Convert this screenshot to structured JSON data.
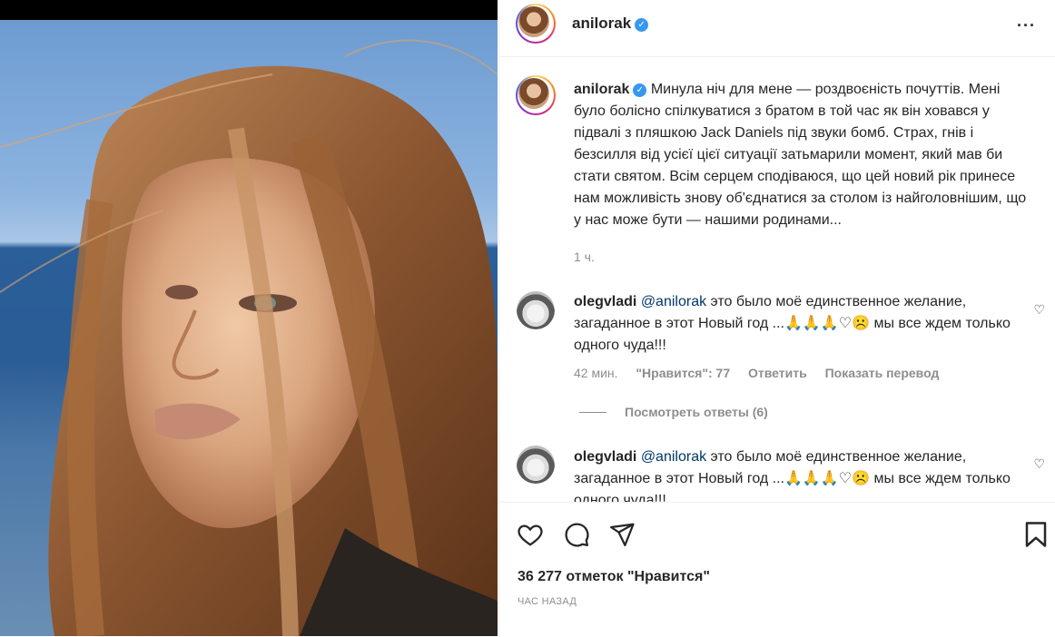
{
  "post": {
    "username": "anilorak",
    "verified_mark": "✓",
    "more_icon": "···",
    "caption": "Минула ніч для мене — роздвоєність почуттів. Мені було болісно спілкуватися з братом в той час як він ховався у підвалі з пляшкою Jack Daniels під звуки бомб. Страх, гнів і безсилля від усієї цієї ситуації затьмарили момент, який мав би стати святом. Всім серцем сподіваюся, що цей новий рік принесе нам можливість знову об'єднатися за столом із найголовнішим, що у нас може бути — нашими родинами...",
    "caption_time": "1 ч."
  },
  "comments": [
    {
      "username": "olegvladi",
      "mention": "@anilorak",
      "text": "это было моё единственное желание, загаданное в этот Новый год ...🙏🙏🙏♡☹️ мы все ждем только одного чуда!!!",
      "time": "42 мин.",
      "likes": "\"Нравится\": 77",
      "reply": "Ответить",
      "translate": "Показать перевод",
      "view_replies": "Посмотреть ответы (6)"
    },
    {
      "username": "olegvladi",
      "mention": "@anilorak",
      "text": "это было моё единственное желание, загаданное в этот Новый год ...🙏🙏🙏♡☹️ мы все ждем только одного чуда!!!"
    }
  ],
  "footer": {
    "likes_text": "36 277 отметок \"Нравится\"",
    "time_text": "ЧАС НАЗАД"
  },
  "colors": {
    "text": "#262626",
    "muted": "#8e8e8e",
    "verified": "#3897f0",
    "border": "#efefef"
  },
  "icons": [
    "heart-icon",
    "comment-icon",
    "share-icon",
    "bookmark-icon",
    "more-icon",
    "verified-icon"
  ]
}
